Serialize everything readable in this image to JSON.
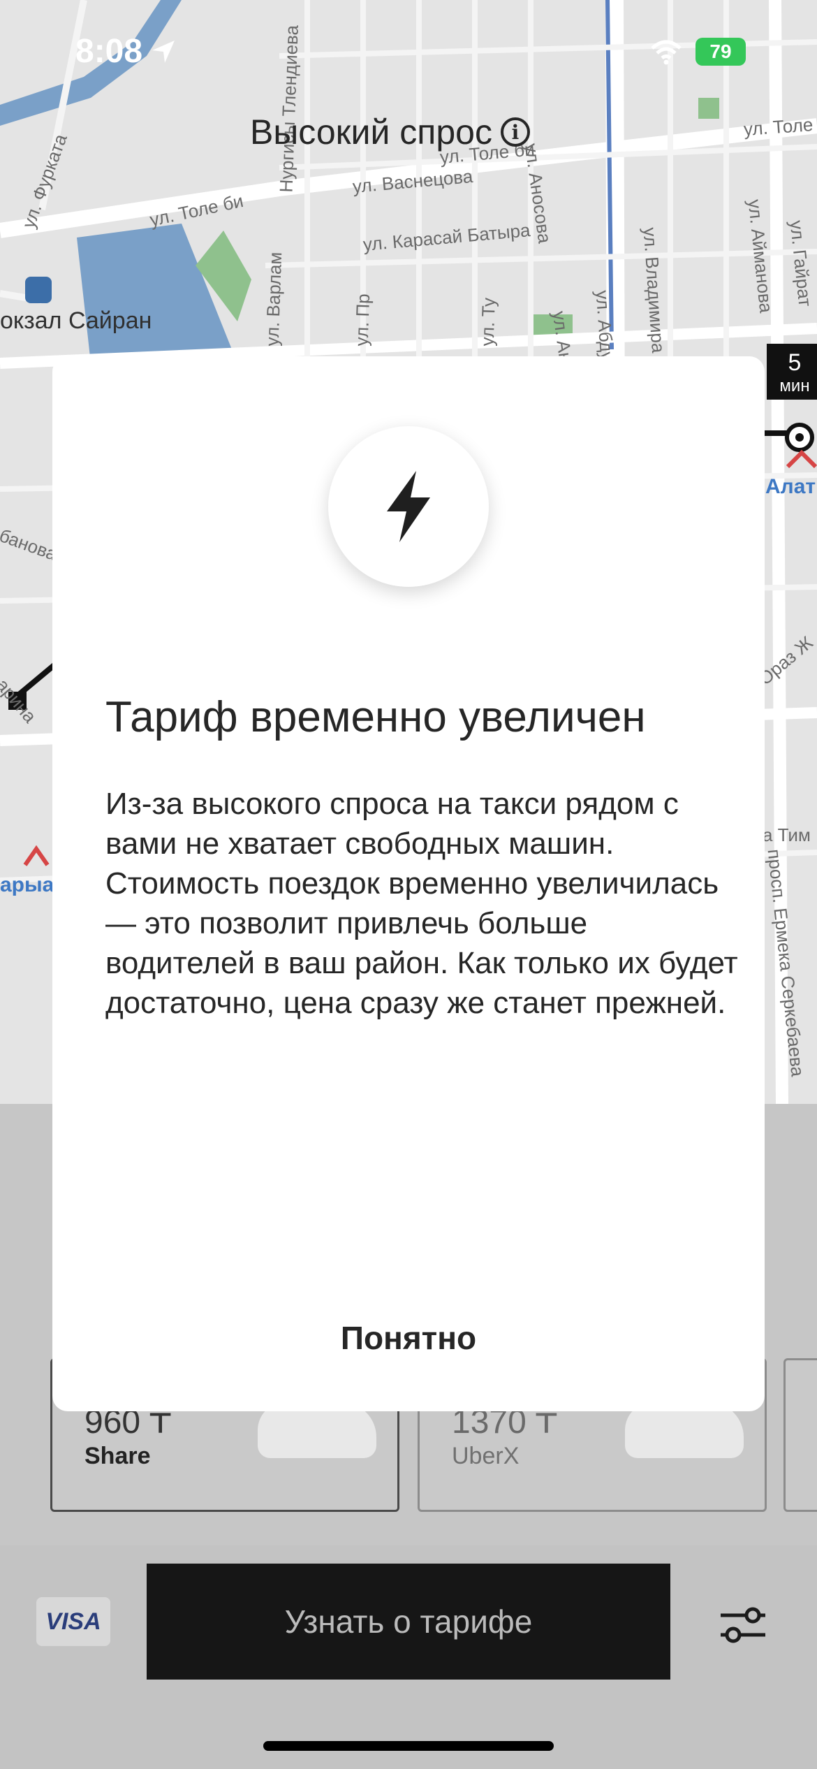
{
  "status_bar": {
    "time": "8:08",
    "battery": "79"
  },
  "map": {
    "demand_label": "Высокий спрос",
    "station_label": "окзал Сайран",
    "eta_number": "5",
    "eta_unit": "мин",
    "metro_labels": [
      "Алат",
      "арыа"
    ],
    "street_labels": [
      "ул. Фурката",
      "ул. Толе би",
      "ул. Васнецова",
      "ул. Карасай Батыра",
      "ул. Аносова",
      "ул. Аносова",
      "ул. Абдуллы Розы",
      "ул. Владимира Радо",
      "ул. Айманова",
      "ул. Гайрат",
      "ул. Толе",
      "Нургисы Тлендиева",
      "ул. Варлам",
      "ул. Пр",
      "ул. Ту",
      "ул. Толе би",
      "Ораз Ж",
      "а Тим",
      "просп. Ермека Серкебаева",
      "банова",
      "арина"
    ]
  },
  "tariffs": [
    {
      "price": "960 ₸",
      "name": "Share"
    },
    {
      "price": "1370 ₸",
      "name": "UberX"
    }
  ],
  "bottom_bar": {
    "payment": "VISA",
    "main_button": "Узнать о тарифе"
  },
  "dialog": {
    "title": "Тариф временно увеличен",
    "body": "Из-за высокого спроса на такси рядом с вами не хватает свободных машин. Стоимость поездок временно увеличилась — это позволит привлечь больше водителей в ваш район. Как только их будет достаточно, цена сразу же станет прежней.",
    "button": "Понятно"
  },
  "colors": {
    "battery": "#34c759",
    "button_bg": "#161616",
    "metro": "#3d78c4",
    "water": "#7aa0c8",
    "park": "#8fc18d"
  }
}
